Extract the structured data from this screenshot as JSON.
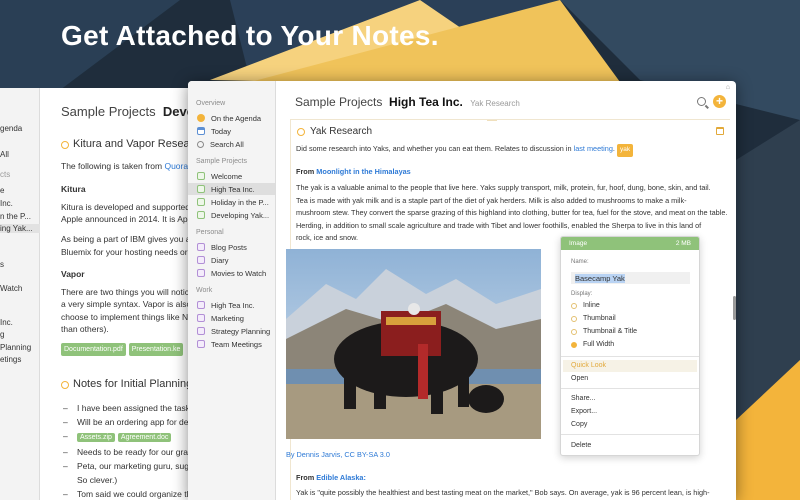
{
  "headline": "Get Attached to Your Notes.",
  "back_window": {
    "sidebar_items": [
      "genda",
      "All",
      "cts",
      "e",
      "Inc.",
      "n the P...",
      "ing Yak...",
      "",
      "s",
      "",
      "Watch",
      "",
      "Inc.",
      "g",
      "Planning",
      "etings"
    ],
    "title_prefix": "Sample Projects",
    "title_bold": "Develop",
    "note1_title": "Kitura and Vapor Researc",
    "line1_a": "The following is taken from ",
    "line1_link": "Quora",
    "kitura_heading": "Kitura",
    "kitura_l1": "Kitura is developed and supported b",
    "kitura_l2": "Apple announced in 2014. It is Apach",
    "ibm_l1": "As being a part of IBM gives you a na",
    "ibm_l2": "Bluemix for your hosting needs or yo",
    "vapor_heading": "Vapor",
    "vapor_l1": "There are two things you will notice a",
    "vapor_l2": "a very simple syntax. Vapor is also the",
    "vapor_l3": "choose to implement things like Nod",
    "vapor_l4": "than others).",
    "tag1": "Documentation.pdf",
    "tag2": "Presentation.ke",
    "note2_title": "Notes for Initial Planning",
    "items": [
      "I have been assigned the task of",
      "Will be an ordering app for deliv",
      "",
      "Needs to be ready for our grand",
      "Peta, our marketing guru, sugge",
      "So clever.)",
      "Tom said we could organize the"
    ],
    "tag3": "Assets.zip",
    "tag4": "Agreement.doc"
  },
  "sidebar": {
    "overview_label": "Overview",
    "overview": [
      "On the Agenda",
      "Today",
      "Search All"
    ],
    "sample_label": "Sample Projects",
    "sample": [
      "Welcome",
      "High Tea Inc.",
      "Holiday in the P...",
      "Developing Yak..."
    ],
    "personal_label": "Personal",
    "personal": [
      "Blog Posts",
      "Diary",
      "Movies to Watch"
    ],
    "work_label": "Work",
    "work": [
      "High Tea Inc.",
      "Marketing",
      "Strategy Planning",
      "Team Meetings"
    ]
  },
  "header": {
    "prefix": "Sample Projects",
    "title": "High Tea Inc.",
    "subtitle": "Yak Research",
    "add_glyph": "+"
  },
  "note": {
    "title": "Yak Research",
    "intro_a": "Did some research into Yaks, and whether you can eat them. Relates to discussion in ",
    "intro_link": "last meeting",
    "intro_b": ".",
    "tag": "yak",
    "from1_prefix": "From ",
    "from1_link": "Moonlight in the Himalayas",
    "para1": [
      "The yak is a valuable animal to the people that live here. Yaks supply transport, milk, protein, fur, hoof, dung, bone, skin, and tail.",
      "Tea is made with yak milk and is a staple part of the diet of yak herders. Milk is also added to mushrooms to make a milk-",
      "mushroom stew. They convert the sparse grazing of this highland into clothing, butter for tea, fuel for the stove, and meat on the table.",
      "Herding, in addition to small scale agriculture and trade with Tibet and lower foothills, enabled the Sherpa to live in this land of",
      "rock, ice and snow."
    ],
    "caption": "By Dennis Jarvis, CC BY-SA 3.0",
    "from2_prefix": "From ",
    "from2_link": "Edible Alaska:",
    "para2": "Yak is \"quite possibly the healthiest and best tasting meat on the market,\" Bob says. On average, yak is 96 percent lean, is high-"
  },
  "popover": {
    "header_left": "Image",
    "header_right": "2 MB",
    "name_label": "Name:",
    "name_value": "Basecamp Yak",
    "display_label": "Display:",
    "options": [
      "Inline",
      "Thumbnail",
      "Thumbnail & Title",
      "Full Width"
    ],
    "selected_option": "Full Width",
    "menu": [
      "Quick Look",
      "Open",
      "Share...",
      "Export...",
      "Copy",
      "Delete"
    ]
  },
  "colors": {
    "accent": "#f3b43b",
    "link": "#2e7ad6",
    "tag_green": "#8fc27a",
    "background": "#1f2d3c"
  }
}
